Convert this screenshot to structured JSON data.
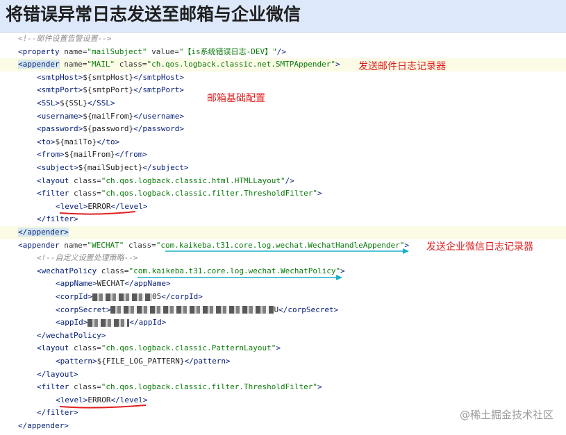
{
  "title": "将错误异常日志发送至邮箱与企业微信",
  "annotations": {
    "mail_appender": "发送邮件日志记录器",
    "mail_basic_config": "邮箱基础配置",
    "wechat_appender": "发送企业微信日志记录器"
  },
  "watermark": "@稀土掘金技术社区",
  "code": {
    "l1": "<!--邮件设置告警设置-->",
    "l2_tag": "property",
    "l2_name_val": "\"mailSubject\"",
    "l2_value_val": "\"【is系统错误日志-DEV】\"",
    "l3_tag": "appender",
    "l3_name_val": "\"MAIL\"",
    "l3_class_val": "\"ch.qos.logback.classic.net.SMTPAppender\"",
    "l4": "${smtpHost}",
    "l5": "${smtpPort}",
    "l6": "${SSL}",
    "l7": "${mailFrom}",
    "l8": "${password}",
    "l9": "${mailTo}",
    "l10": "${mailFrom}",
    "l11": "${mailSubject}",
    "l12_class_val": "\"ch.qos.logback.classic.html.HTMLLayout\"",
    "l13_class_val": "\"ch.qos.logback.classic.filter.ThresholdFilter\"",
    "l14": "ERROR",
    "l17_name_val": "\"WECHAT\"",
    "l17_class_val": "\"com.kaikeba.t31.core.log.wechat.WechatHandleAppender\"",
    "l18": "<!--自定义设置处理策略-->",
    "l19_class_val": "\"com.kaikeba.t31.core.log.wechat.WechatPolicy\"",
    "l20": "WECHAT",
    "l21_tail": "05",
    "l22_tail": "U",
    "l25_class_val": "\"ch.qos.logback.classic.PatternLayout\"",
    "l26": "${FILE_LOG_PATTERN}",
    "l28_class_val": "\"ch.qos.logback.classic.filter.ThresholdFilter\"",
    "l29": "ERROR"
  }
}
